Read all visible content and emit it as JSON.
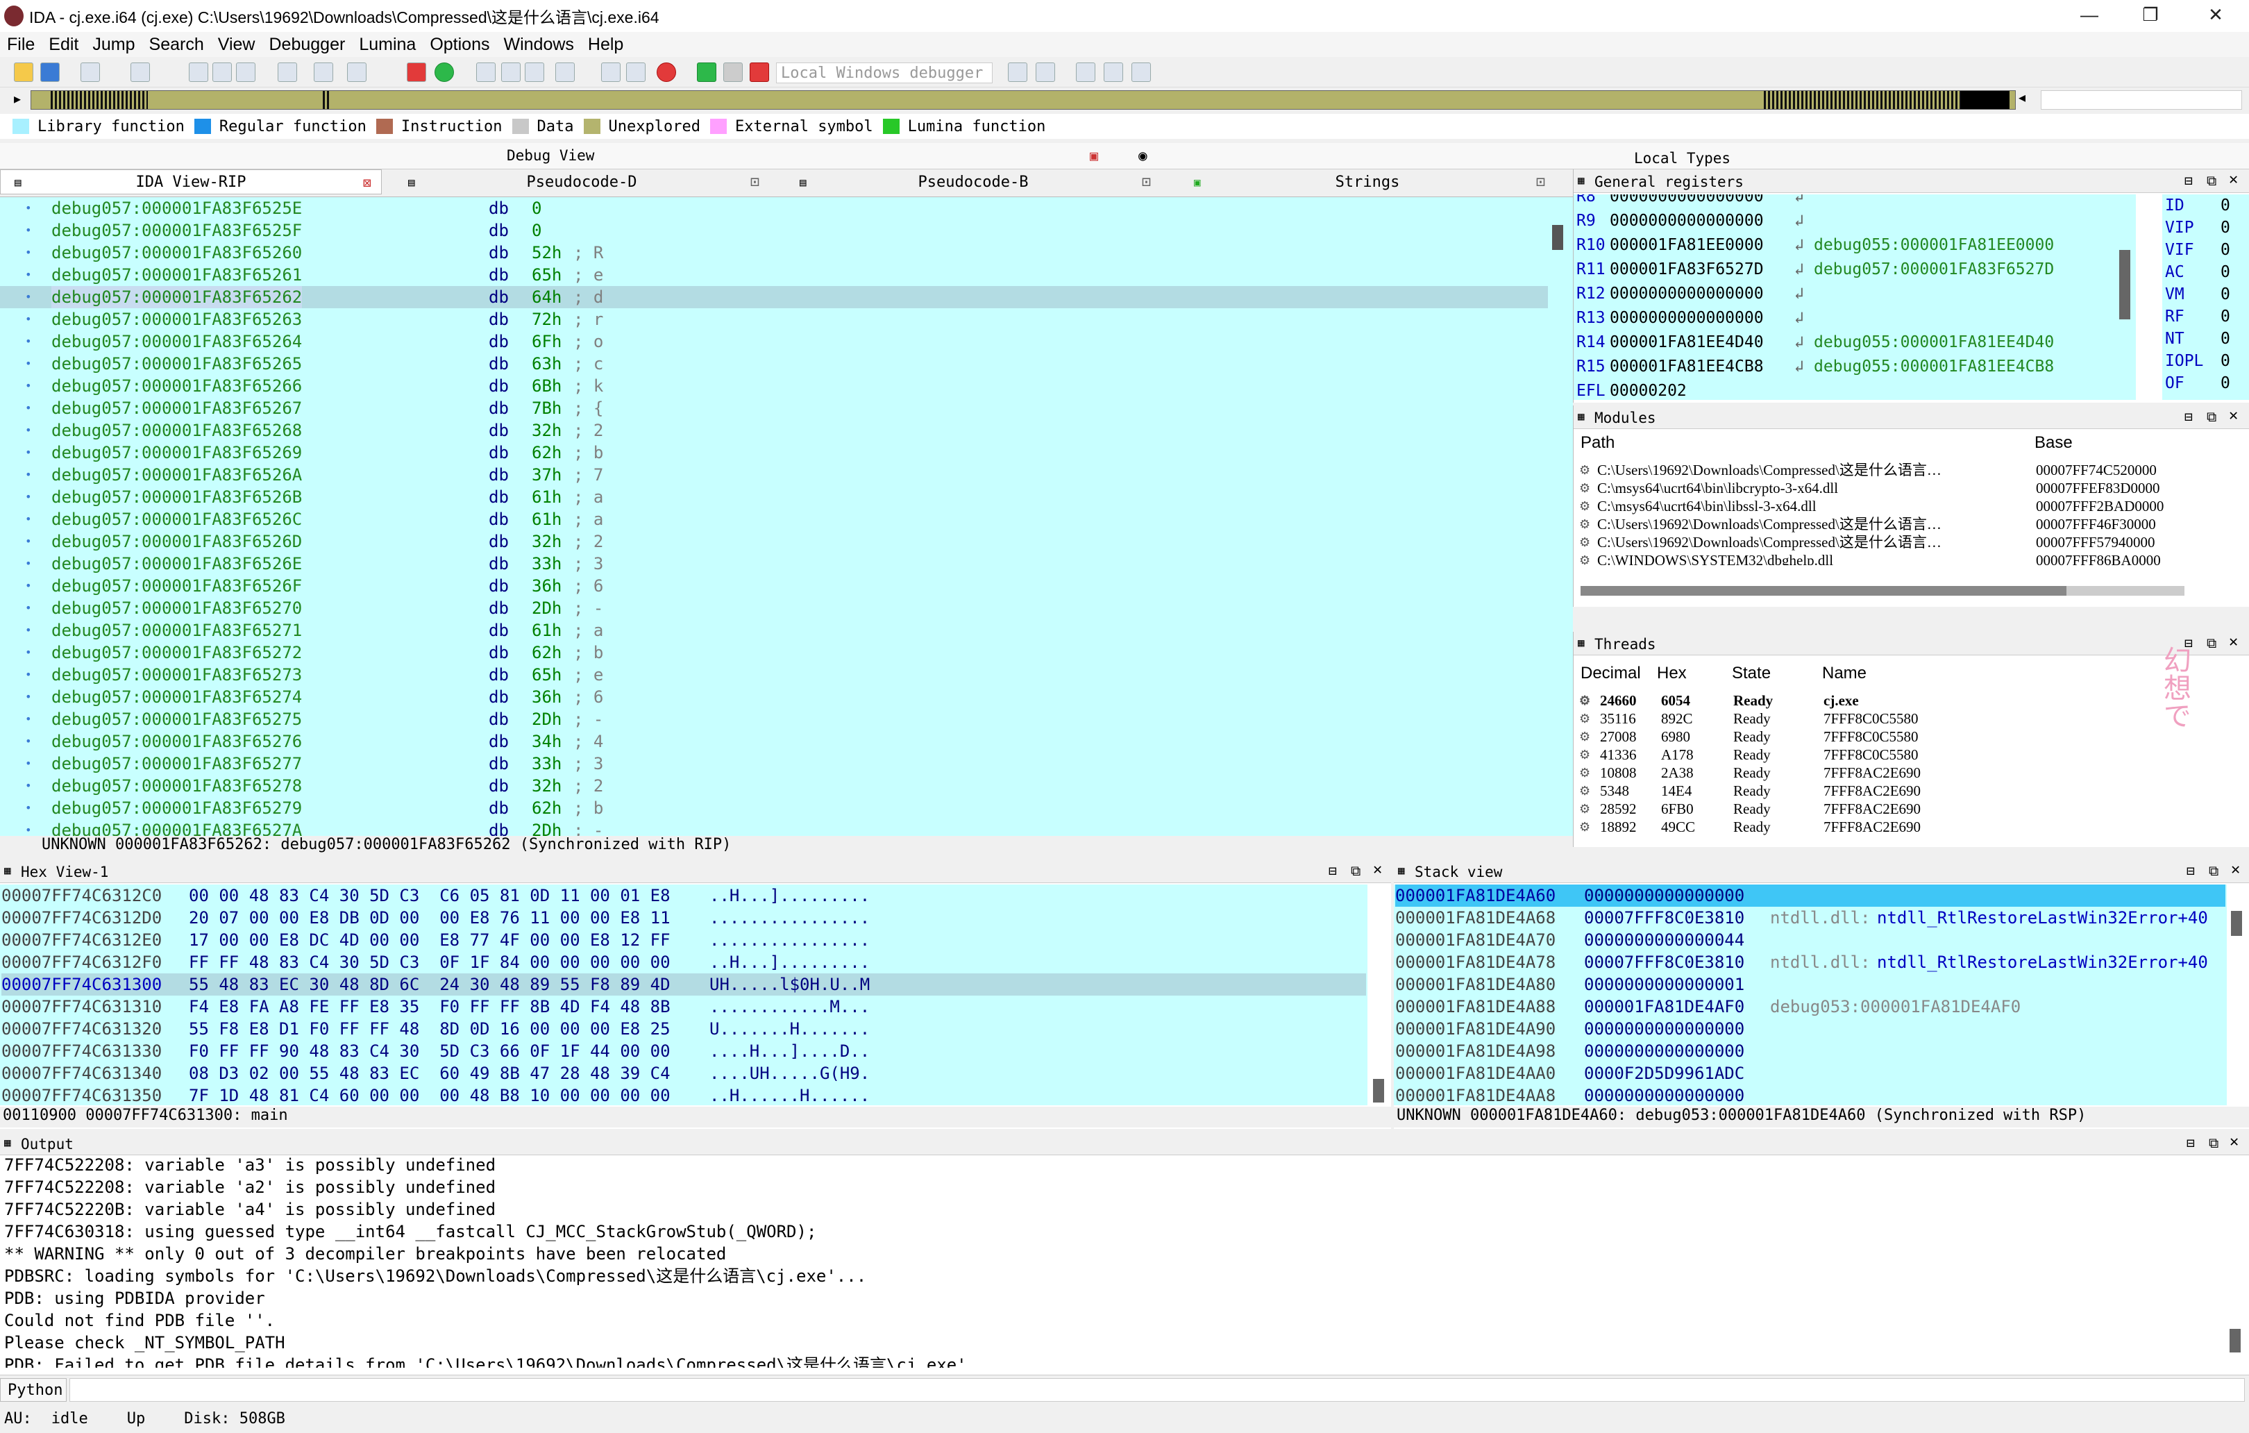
{
  "title": "IDA - cj.exe.i64 (cj.exe) C:\\Users\\19692\\Downloads\\Compressed\\这是什么语言\\cj.exe.i64",
  "window_controls": {
    "min": "—",
    "max": "❐",
    "close": "✕"
  },
  "menu": [
    "File",
    "Edit",
    "Jump",
    "Search",
    "View",
    "Debugger",
    "Lumina",
    "Options",
    "Windows",
    "Help"
  ],
  "debugger_select": "Local Windows debugger",
  "legend": [
    {
      "label": "Library function",
      "color": "#a8f0ff"
    },
    {
      "label": "Regular function",
      "color": "#1e90e8"
    },
    {
      "label": "Instruction",
      "color": "#b06a52"
    },
    {
      "label": "Data",
      "color": "#c8c8c8"
    },
    {
      "label": "Unexplored",
      "color": "#b4b46e"
    },
    {
      "label": "External symbol",
      "color": "#ffa0ff"
    },
    {
      "label": "Lumina function",
      "color": "#28c828"
    }
  ],
  "panes": {
    "debug_view": "Debug View",
    "local_types": "Local Types",
    "tabs": [
      "IDA View-RIP",
      "Pseudocode-D",
      "Pseudocode-B",
      "Strings"
    ]
  },
  "disasm": {
    "lines": [
      {
        "addr": "debug057:000001FA83F6525E",
        "op": "db",
        "val": "0",
        "cmt": ""
      },
      {
        "addr": "debug057:000001FA83F6525F",
        "op": "db",
        "val": "0",
        "cmt": ""
      },
      {
        "addr": "debug057:000001FA83F65260",
        "op": "db",
        "val": "52h",
        "cmt": "; R"
      },
      {
        "addr": "debug057:000001FA83F65261",
        "op": "db",
        "val": "65h",
        "cmt": "; e"
      },
      {
        "addr": "debug057:000001FA83F65262",
        "op": "db",
        "val": "64h",
        "cmt": "; d"
      },
      {
        "addr": "debug057:000001FA83F65263",
        "op": "db",
        "val": "72h",
        "cmt": "; r"
      },
      {
        "addr": "debug057:000001FA83F65264",
        "op": "db",
        "val": "6Fh",
        "cmt": "; o"
      },
      {
        "addr": "debug057:000001FA83F65265",
        "op": "db",
        "val": "63h",
        "cmt": "; c"
      },
      {
        "addr": "debug057:000001FA83F65266",
        "op": "db",
        "val": "6Bh",
        "cmt": "; k"
      },
      {
        "addr": "debug057:000001FA83F65267",
        "op": "db",
        "val": "7Bh",
        "cmt": "; {"
      },
      {
        "addr": "debug057:000001FA83F65268",
        "op": "db",
        "val": "32h",
        "cmt": "; 2"
      },
      {
        "addr": "debug057:000001FA83F65269",
        "op": "db",
        "val": "62h",
        "cmt": "; b"
      },
      {
        "addr": "debug057:000001FA83F6526A",
        "op": "db",
        "val": "37h",
        "cmt": "; 7"
      },
      {
        "addr": "debug057:000001FA83F6526B",
        "op": "db",
        "val": "61h",
        "cmt": "; a"
      },
      {
        "addr": "debug057:000001FA83F6526C",
        "op": "db",
        "val": "61h",
        "cmt": "; a"
      },
      {
        "addr": "debug057:000001FA83F6526D",
        "op": "db",
        "val": "32h",
        "cmt": "; 2"
      },
      {
        "addr": "debug057:000001FA83F6526E",
        "op": "db",
        "val": "33h",
        "cmt": "; 3"
      },
      {
        "addr": "debug057:000001FA83F6526F",
        "op": "db",
        "val": "36h",
        "cmt": "; 6"
      },
      {
        "addr": "debug057:000001FA83F65270",
        "op": "db",
        "val": "2Dh",
        "cmt": "; -"
      },
      {
        "addr": "debug057:000001FA83F65271",
        "op": "db",
        "val": "61h",
        "cmt": "; a"
      },
      {
        "addr": "debug057:000001FA83F65272",
        "op": "db",
        "val": "62h",
        "cmt": "; b"
      },
      {
        "addr": "debug057:000001FA83F65273",
        "op": "db",
        "val": "65h",
        "cmt": "; e"
      },
      {
        "addr": "debug057:000001FA83F65274",
        "op": "db",
        "val": "36h",
        "cmt": "; 6"
      },
      {
        "addr": "debug057:000001FA83F65275",
        "op": "db",
        "val": "2Dh",
        "cmt": "; -"
      },
      {
        "addr": "debug057:000001FA83F65276",
        "op": "db",
        "val": "34h",
        "cmt": "; 4"
      },
      {
        "addr": "debug057:000001FA83F65277",
        "op": "db",
        "val": "33h",
        "cmt": "; 3"
      },
      {
        "addr": "debug057:000001FA83F65278",
        "op": "db",
        "val": "32h",
        "cmt": "; 2"
      },
      {
        "addr": "debug057:000001FA83F65279",
        "op": "db",
        "val": "62h",
        "cmt": "; b"
      },
      {
        "addr": "debug057:000001FA83F6527A",
        "op": "db",
        "val": "2Dh",
        "cmt": "; -"
      }
    ],
    "status": "UNKNOWN 000001FA83F65262: debug057:000001FA83F65262 (Synchronized with RIP)"
  },
  "registers": {
    "title": "General registers",
    "rows": [
      {
        "name": "R8",
        "val": "0000000000000000",
        "ref": ""
      },
      {
        "name": "R9",
        "val": "0000000000000000",
        "ref": ""
      },
      {
        "name": "R10",
        "val": "000001FA81EE0000",
        "ref": "debug055:000001FA81EE0000"
      },
      {
        "name": "R11",
        "val": "000001FA83F6527D",
        "ref": "debug057:000001FA83F6527D"
      },
      {
        "name": "R12",
        "val": "0000000000000000",
        "ref": ""
      },
      {
        "name": "R13",
        "val": "0000000000000000",
        "ref": ""
      },
      {
        "name": "R14",
        "val": "000001FA81EE4D40",
        "ref": "debug055:000001FA81EE4D40"
      },
      {
        "name": "R15",
        "val": "000001FA81EE4CB8",
        "ref": "debug055:000001FA81EE4CB8"
      },
      {
        "name": "EFL",
        "val": "00000202",
        "ref": ""
      }
    ],
    "flags": [
      {
        "name": "ID",
        "val": "0"
      },
      {
        "name": "VIP",
        "val": "0"
      },
      {
        "name": "VIF",
        "val": "0"
      },
      {
        "name": "AC",
        "val": "0"
      },
      {
        "name": "VM",
        "val": "0"
      },
      {
        "name": "RF",
        "val": "0"
      },
      {
        "name": "NT",
        "val": "0"
      },
      {
        "name": "IOPL",
        "val": "0"
      },
      {
        "name": "OF",
        "val": "0"
      }
    ]
  },
  "modules": {
    "title": "Modules",
    "headers": [
      "Path",
      "Base"
    ],
    "rows": [
      {
        "path": "C:\\Users\\19692\\Downloads\\Compressed\\这是什么语言…",
        "base": "00007FF74C520000"
      },
      {
        "path": "C:\\msys64\\ucrt64\\bin\\libcrypto-3-x64.dll",
        "base": "00007FFEF83D0000"
      },
      {
        "path": "C:\\msys64\\ucrt64\\bin\\libssl-3-x64.dll",
        "base": "00007FFF2BAD0000"
      },
      {
        "path": "C:\\Users\\19692\\Downloads\\Compressed\\这是什么语言…",
        "base": "00007FFF46F30000"
      },
      {
        "path": "C:\\Users\\19692\\Downloads\\Compressed\\这是什么语言…",
        "base": "00007FFF57940000"
      },
      {
        "path": "C:\\WINDOWS\\SYSTEM32\\dbghelp.dll",
        "base": "00007FFF86BA0000"
      }
    ]
  },
  "threads": {
    "title": "Threads",
    "headers": [
      "Decimal",
      "Hex",
      "State",
      "Name"
    ],
    "rows": [
      {
        "dec": "24660",
        "hex": "6054",
        "state": "Ready",
        "name": "cj.exe"
      },
      {
        "dec": "35116",
        "hex": "892C",
        "state": "Ready",
        "name": "7FFF8C0C5580"
      },
      {
        "dec": "27008",
        "hex": "6980",
        "state": "Ready",
        "name": "7FFF8C0C5580"
      },
      {
        "dec": "41336",
        "hex": "A178",
        "state": "Ready",
        "name": "7FFF8C0C5580"
      },
      {
        "dec": "10808",
        "hex": "2A38",
        "state": "Ready",
        "name": "7FFF8AC2E690"
      },
      {
        "dec": "5348",
        "hex": "14E4",
        "state": "Ready",
        "name": "7FFF8AC2E690"
      },
      {
        "dec": "28592",
        "hex": "6FB0",
        "state": "Ready",
        "name": "7FFF8AC2E690"
      },
      {
        "dec": "18892",
        "hex": "49CC",
        "state": "Ready",
        "name": "7FFF8AC2E690"
      }
    ]
  },
  "hexview": {
    "title": "Hex View-1",
    "rows": [
      {
        "addr": "00007FF74C6312C0",
        "bytes": "00 00 48 83 C4 30 5D C3  C6 05 81 0D 11 00 01 E8",
        "ascii": "..H...]........."
      },
      {
        "addr": "00007FF74C6312D0",
        "bytes": "20 07 00 00 E8 DB 0D 00  00 E8 76 11 00 00 E8 11",
        "ascii": "................"
      },
      {
        "addr": "00007FF74C6312E0",
        "bytes": "17 00 00 E8 DC 4D 00 00  E8 77 4F 00 00 E8 12 FF",
        "ascii": "................"
      },
      {
        "addr": "00007FF74C6312F0",
        "bytes": "FF FF 48 83 C4 30 5D C3  0F 1F 84 00 00 00 00 00",
        "ascii": "..H...]........."
      },
      {
        "addr": "00007FF74C631300",
        "bytes": "55 48 83 EC 30 48 8D 6C  24 30 48 89 55 F8 89 4D",
        "ascii": "UH.....l$0H.U..M"
      },
      {
        "addr": "00007FF74C631310",
        "bytes": "F4 E8 FA A8 FE FF E8 35  F0 FF FF 8B 4D F4 48 8B",
        "ascii": "............M..."
      },
      {
        "addr": "00007FF74C631320",
        "bytes": "55 F8 E8 D1 F0 FF FF 48  8D 0D 16 00 00 00 E8 25",
        "ascii": "U.......H......."
      },
      {
        "addr": "00007FF74C631330",
        "bytes": "F0 FF FF 90 48 83 C4 30  5D C3 66 0F 1F 44 00 00",
        "ascii": "....H...]....D.."
      },
      {
        "addr": "00007FF74C631340",
        "bytes": "08 D3 02 00 55 48 83 EC  60 49 8B 47 28 48 39 C4",
        "ascii": "....UH.....G(H9."
      },
      {
        "addr": "00007FF74C631350",
        "bytes": "7F 1D 48 81 C4 60 00 00  00 48 B8 10 00 00 00 00",
        "ascii": "..H......H......"
      }
    ],
    "status": "00110900 00007FF74C631300: main"
  },
  "stack": {
    "title": "Stack view",
    "rows": [
      {
        "addr": "000001FA81DE4A60",
        "val": "0000000000000000",
        "ref": "",
        "sym": ""
      },
      {
        "addr": "000001FA81DE4A68",
        "val": "00007FFF8C0E3810",
        "ref": "ntdll.dll:",
        "sym": "ntdll_RtlRestoreLastWin32Error+40"
      },
      {
        "addr": "000001FA81DE4A70",
        "val": "0000000000000044",
        "ref": "",
        "sym": ""
      },
      {
        "addr": "000001FA81DE4A78",
        "val": "00007FFF8C0E3810",
        "ref": "ntdll.dll:",
        "sym": "ntdll_RtlRestoreLastWin32Error+40"
      },
      {
        "addr": "000001FA81DE4A80",
        "val": "0000000000000001",
        "ref": "",
        "sym": ""
      },
      {
        "addr": "000001FA81DE4A88",
        "val": "000001FA81DE4AF0",
        "ref": "debug053:000001FA81DE4AF0",
        "sym": ""
      },
      {
        "addr": "000001FA81DE4A90",
        "val": "0000000000000000",
        "ref": "",
        "sym": ""
      },
      {
        "addr": "000001FA81DE4A98",
        "val": "0000000000000000",
        "ref": "",
        "sym": ""
      },
      {
        "addr": "000001FA81DE4AA0",
        "val": "0000F2D5D9961ADC",
        "ref": "",
        "sym": ""
      },
      {
        "addr": "000001FA81DE4AA8",
        "val": "0000000000000000",
        "ref": "",
        "sym": ""
      }
    ],
    "status": "UNKNOWN 000001FA81DE4A60: debug053:000001FA81DE4A60 (Synchronized with RSP)"
  },
  "output": {
    "title": "Output",
    "lines": [
      "7FF74C522208: variable 'a3' is possibly undefined",
      "7FF74C522208: variable 'a2' is possibly undefined",
      "7FF74C52220B: variable 'a4' is possibly undefined",
      "7FF74C630318: using guessed type __int64 __fastcall CJ_MCC_StackGrowStub(_QWORD);",
      "** WARNING ** only 0 out of 3 decompiler breakpoints have been relocated",
      "PDBSRC: loading symbols for 'C:\\Users\\19692\\Downloads\\Compressed\\这是什么语言\\cj.exe'...",
      "PDB: using PDBIDA provider",
      "Could not find PDB file ''.",
      "Please check _NT_SYMBOL_PATH",
      "PDB: Failed to get PDB file details from 'C:\\Users\\19692\\Downloads\\Compressed\\这是什么语言\\cj.exe'"
    ],
    "lang_button": "Python"
  },
  "statusbar": {
    "au": "AU:",
    "state": "idle",
    "dir": "Up",
    "disk": "Disk: 508GB"
  },
  "watermark": "幻想で"
}
